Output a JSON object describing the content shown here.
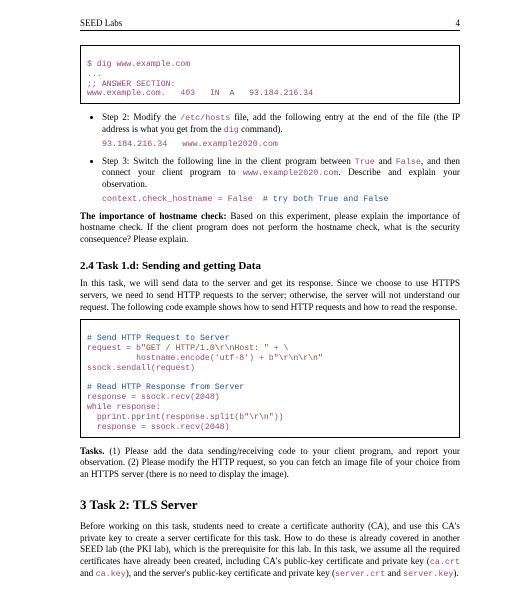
{
  "header": {
    "title": "SEED Labs",
    "page_number": "4"
  },
  "code_block_1": {
    "l1": "$ dig www.example.com",
    "l2": "...",
    "l3": ";; ANSWER SECTION:",
    "l4": "www.example.com.   403   IN  A   93.184.216.34"
  },
  "step2": {
    "lead": "Step 2: Modify the ",
    "file": "/etc/hosts",
    "mid": " file, add the following entry at the end of the file (the IP address is what you get from the ",
    "cmd": "dig",
    "tail": " command).",
    "codeline": "93.184.216.34   www.example2020.com"
  },
  "step3": {
    "lead": "Step 3: Switch the following line in the client program between ",
    "true": "True",
    "and": " and ",
    "false": "False",
    "mid": ", and then connect your client program to ",
    "host": "www.example2020.com",
    "tail": ". Describe and explain your observation.",
    "codeline": "context.check_hostname = False  ",
    "comment": "# try both True and False"
  },
  "importance": {
    "lead": "The importance of hostname check:",
    "body": "   Based on this experiment, please explain the importance of hostname check. If the client program does not perform the hostname check, what is the security consequence? Please explain."
  },
  "task1d": {
    "heading": "2.4   Task 1.d: Sending and getting Data",
    "para1a": "In this task, we will send data to the server and get its response. Since we choose to use HTTPS servers, we need to send HTTP requests to the server; otherwise, the server will not understand our request. The following code example shows how to send HTTP requests and how to read the response."
  },
  "code_block_2": {
    "c1": "# Send HTTP Request to Server",
    "l2a": "request = b",
    "l2b": "\"GET / HTTP/1.0\\r\\nHost: \"",
    "l2c": " + \\",
    "l3a": "          hostname.encode('utf-8') + b",
    "l3b": "\"\\r\\n\\r\\n\"",
    "l4": "ssock.sendall(request)",
    "blank": "",
    "c2": "# Read HTTP Response from Server",
    "l6": "response = ssock.recv(2048)",
    "l7": "while response:",
    "l8a": "  pprint.pprint(response.split(b",
    "l8b": "\"\\r\\n\"",
    "l8c": "))",
    "l9": "  response = ssock.recv(2048)"
  },
  "tasks": {
    "lead": "Tasks.",
    "body": "   (1) Please add the data sending/receiving code to your client program, and report your observation. (2) Please modify the HTTP request, so you can fetch an image file of your choice from an HTTPS server (there is no need to display the image)."
  },
  "task2": {
    "heading": "3    Task 2: TLS Server",
    "para_a": "Before working on this task, students need to create a certificate authority (CA), and use this CA's private key to create a server certificate for this task. How to do these is already covered in another SEED lab (the PKI lab), which is the prerequisite for this lab. In this task, we assume all the required certificates have already been created, including CA's public-key certificate and private key (",
    "ca_crt": "ca.crt",
    "and1": " and ",
    "ca_key": "ca.key",
    "para_b": "), and the server's public-key certificate and private key (",
    "srv_crt": "server.crt",
    "and2": " and ",
    "srv_key": "server.key",
    "para_c": ")."
  }
}
